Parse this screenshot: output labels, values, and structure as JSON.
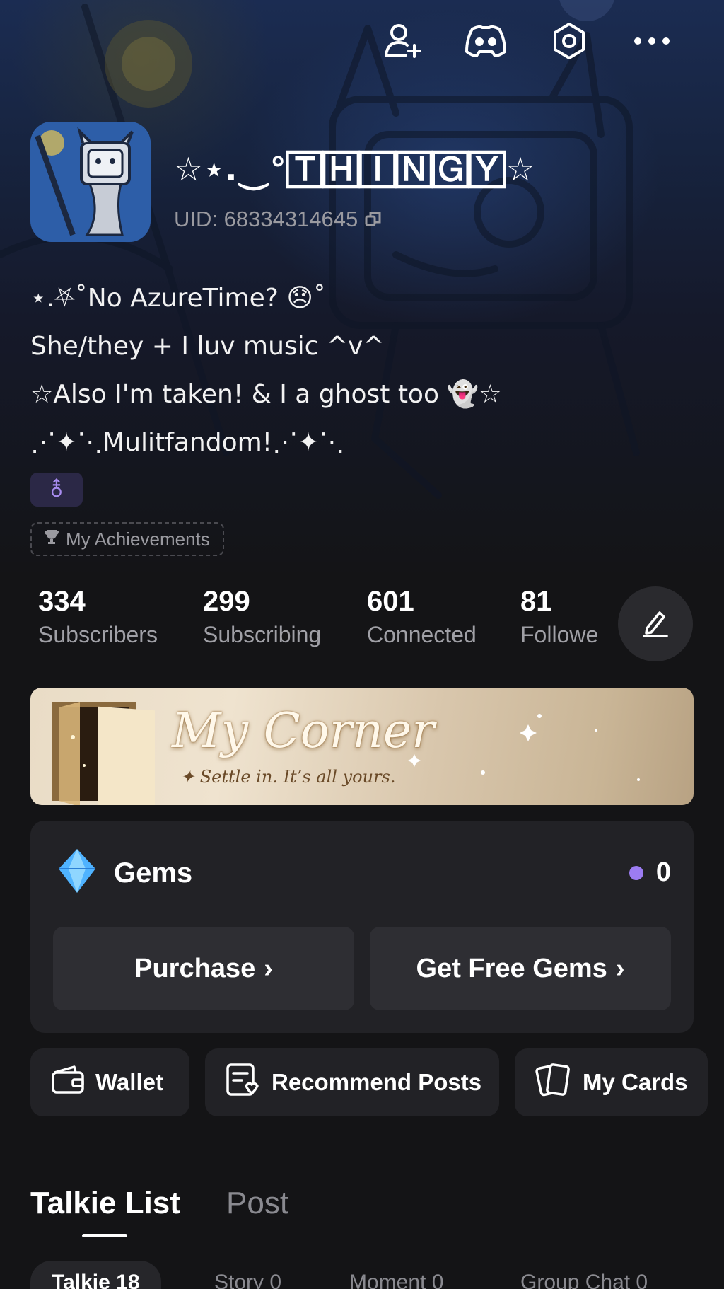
{
  "header": {
    "icons": [
      "add-friend-icon",
      "discord-icon",
      "settings-icon",
      "more-icon"
    ]
  },
  "profile": {
    "username": "☆⋆.⏝°🅃🄷🄸🄽🄶🅈☆",
    "uid_label": "UID: 68334314645",
    "bio": [
      "⋆.⛧˚No AzureTime? 😞˚",
      "She/they + I luv music ^v^",
      "☆Also I'm taken! & I a ghost too 👻☆",
      "⋰✦⋱Mulitfandom!⋰✦⋱"
    ],
    "pronoun_symbol": "⚨",
    "achievements_label": "My Achievements"
  },
  "stats": [
    {
      "value": "334",
      "label": "Subscribers"
    },
    {
      "value": "299",
      "label": "Subscribing"
    },
    {
      "value": "601",
      "label": "Connected"
    },
    {
      "value": "81",
      "label": "Followe"
    }
  ],
  "banner": {
    "title": "My Corner",
    "subtitle": "✦ Settle in. It’s all yours."
  },
  "gems": {
    "title": "Gems",
    "count": "0",
    "purchase_label": "Purchase",
    "free_label": "Get Free Gems",
    "chevron": "›",
    "dot_color": "#9c7cf2"
  },
  "quick_actions": {
    "wallet": "Wallet",
    "recommend": "Recommend Posts",
    "cards": "My Cards"
  },
  "tabs": {
    "talkie_list": "Talkie List",
    "post": "Post"
  },
  "sub_tabs": [
    {
      "label": "Talkie 18"
    },
    {
      "label": "Story 0"
    },
    {
      "label": "Moment 0"
    },
    {
      "label": "Group Chat 0"
    }
  ]
}
